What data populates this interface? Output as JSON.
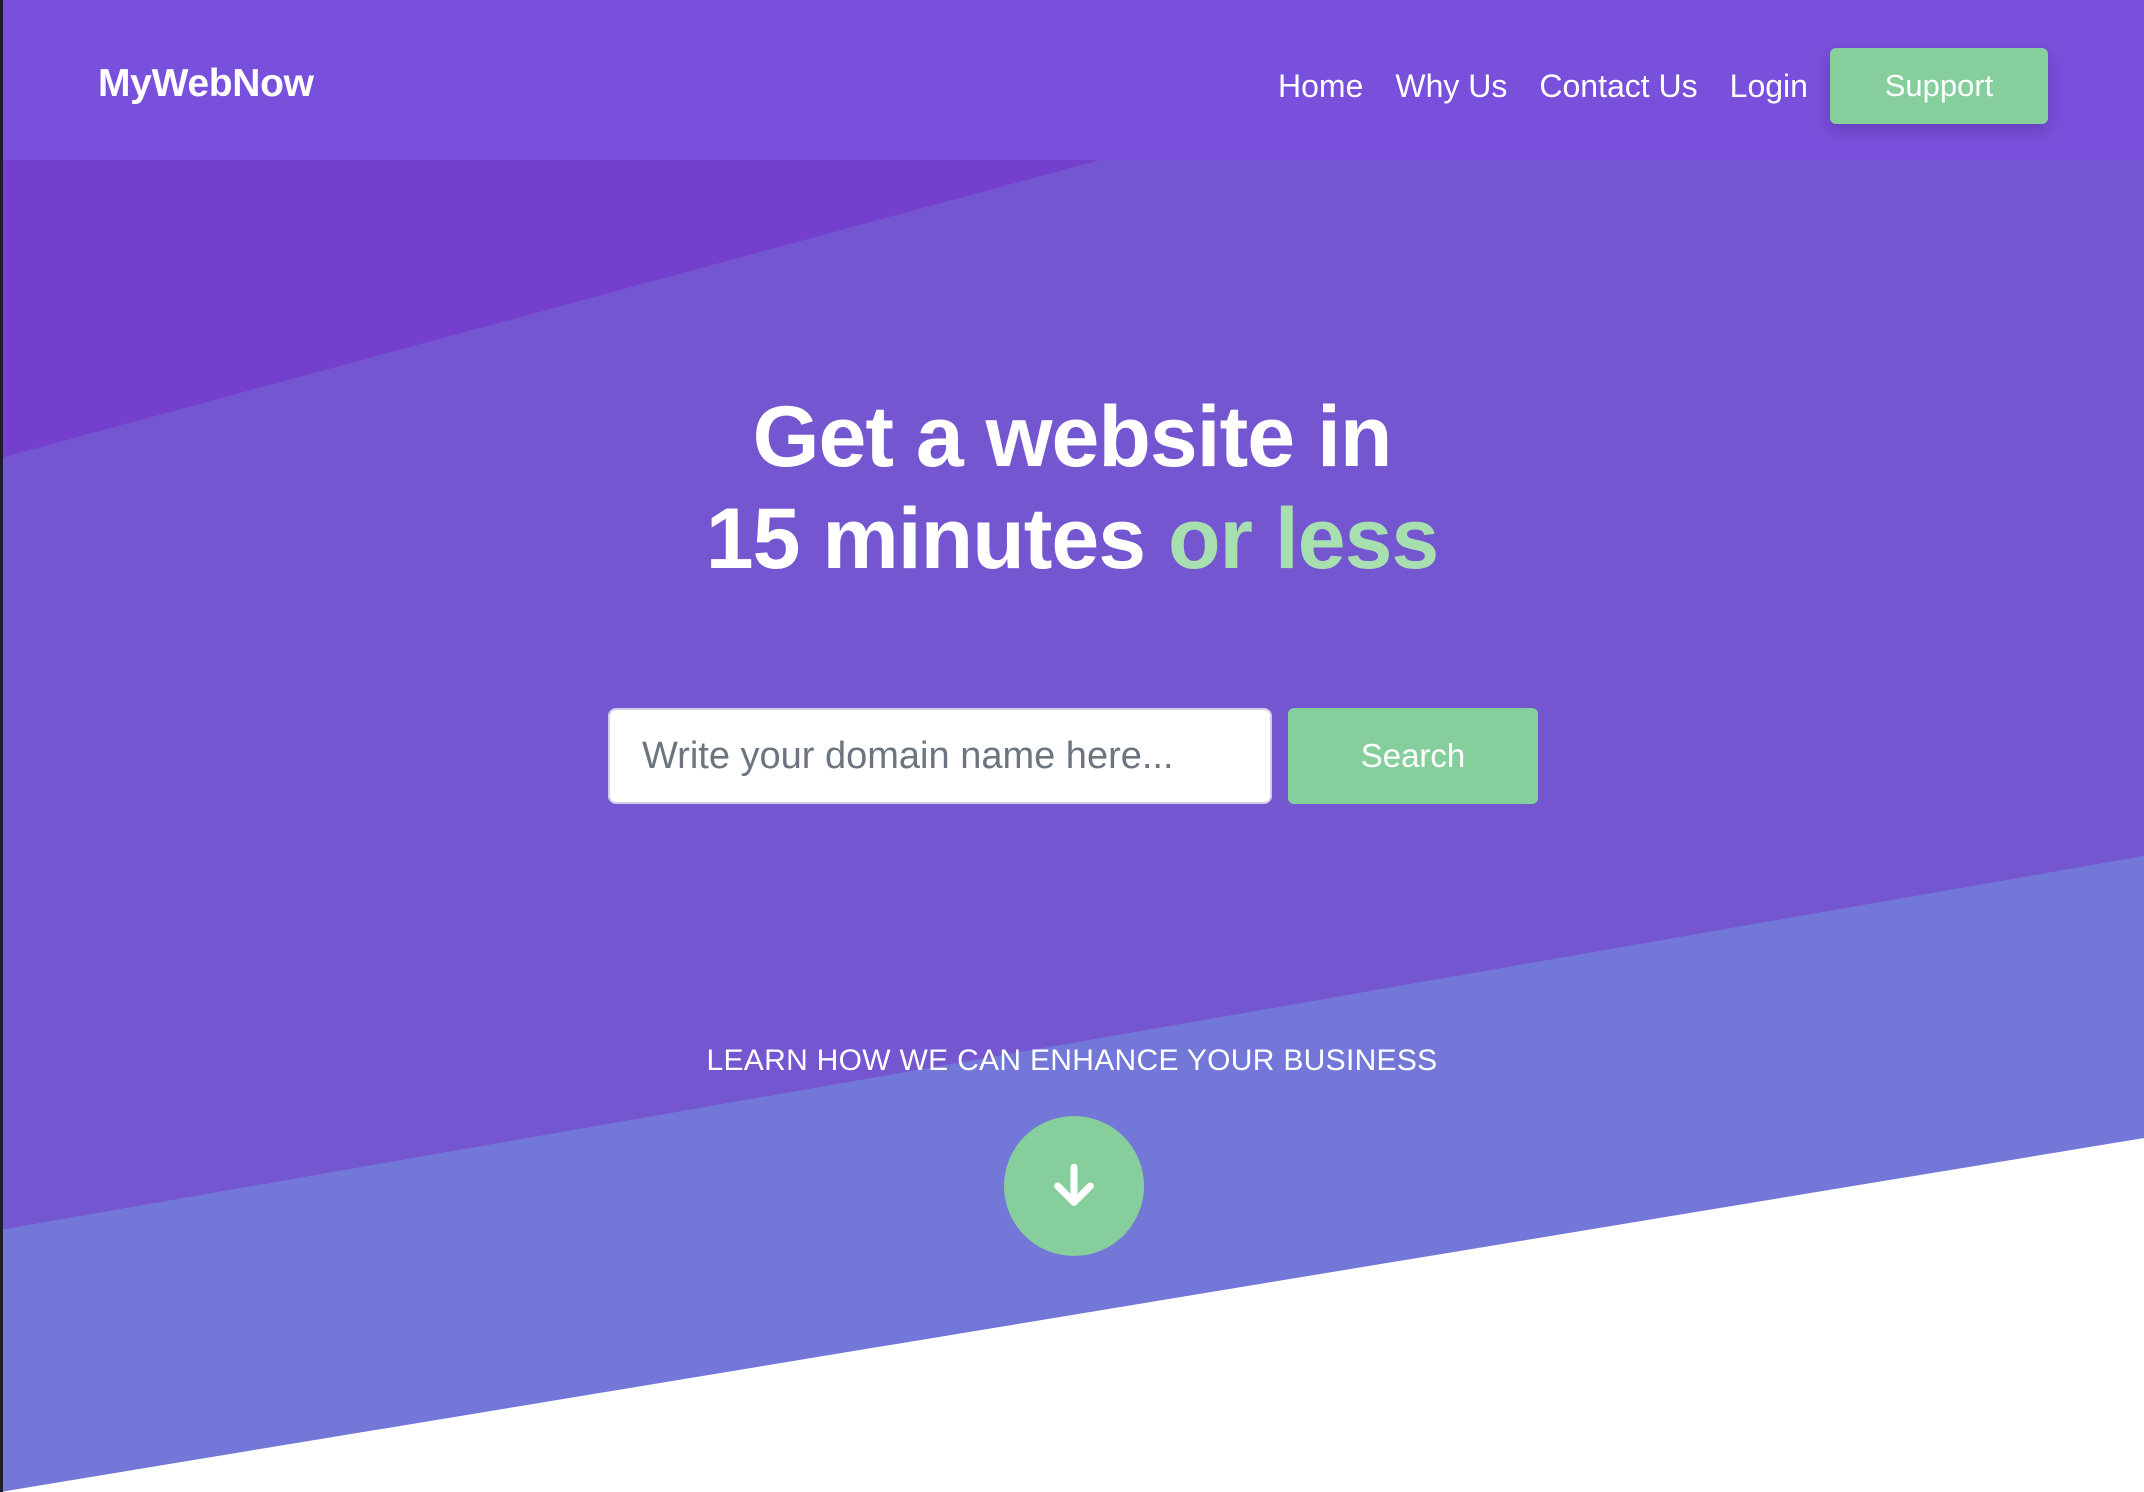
{
  "brand": "MyWebNow",
  "nav": {
    "links": [
      "Home",
      "Why Us",
      "Contact Us",
      "Login"
    ],
    "support_label": "Support"
  },
  "hero": {
    "headline_line1": "Get a website in",
    "headline_line2_main": "15 minutes",
    "headline_line2_accent": "or less",
    "search_placeholder": "Write your domain name here...",
    "search_button": "Search",
    "learn_more": "LEARN HOW WE CAN ENHANCE YOUR BUSINESS",
    "scroll_icon": "arrow-down-icon"
  },
  "colors": {
    "navbar": "#7950db",
    "band_top": "#733fcc",
    "band_middle": "#7456d1",
    "band_bottom": "#7378d8",
    "accent_green": "#86cf9c",
    "accent_text_green": "#a7dfb1",
    "background": "#ffffff"
  }
}
